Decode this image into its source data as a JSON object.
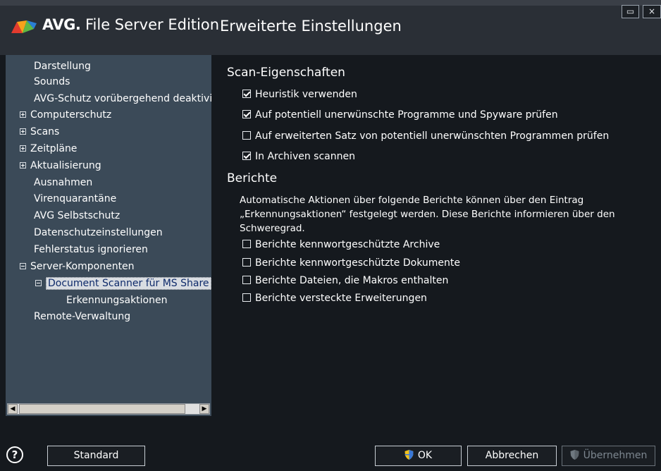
{
  "header": {
    "brand_bold": "AVG.",
    "brand_rest": "File Server Edition",
    "window_title": "Erweiterte Einstellungen",
    "maximize_glyph": "▭",
    "close_glyph": "×"
  },
  "sidebar": {
    "items": [
      {
        "label": "Darstellung"
      },
      {
        "label": "Sounds"
      },
      {
        "label": "AVG-Schutz vorübergehend deaktivie"
      },
      {
        "label": "Computerschutz"
      },
      {
        "label": "Scans"
      },
      {
        "label": "Zeitpläne"
      },
      {
        "label": "Aktualisierung"
      },
      {
        "label": "Ausnahmen"
      },
      {
        "label": "Virenquarantäne"
      },
      {
        "label": "AVG Selbstschutz"
      },
      {
        "label": "Datenschutzeinstellungen"
      },
      {
        "label": "Fehlerstatus ignorieren"
      },
      {
        "label": "Server-Komponenten"
      },
      {
        "label": "Document Scanner für MS Share"
      },
      {
        "label": "Erkennungsaktionen"
      },
      {
        "label": "Remote-Verwaltung"
      }
    ],
    "scroll_left": "◀",
    "scroll_right": "▶"
  },
  "main": {
    "scan_title": "Scan-Eigenschaften",
    "scan_options": [
      {
        "label": "Heuristik verwenden",
        "checked": true
      },
      {
        "label": "Auf potentiell unerwünschte Programme und Spyware prüfen",
        "checked": true
      },
      {
        "label": "Auf erweiterten Satz von potentiell unerwünschten Programmen prüfen",
        "checked": false
      },
      {
        "label": "In Archiven scannen",
        "checked": true
      }
    ],
    "reports_title": "Berichte",
    "reports_description": "Automatische Aktionen über folgende Berichte können über den Eintrag „Erkennungsaktionen“ festgelegt werden. Diese Berichte informieren über den Schweregrad.",
    "report_options": [
      {
        "label": "Berichte kennwortgeschützte Archive",
        "checked": false
      },
      {
        "label": "Berichte kennwortgeschützte Dokumente",
        "checked": false
      },
      {
        "label": "Berichte Dateien, die Makros enthalten",
        "checked": false
      },
      {
        "label": "Berichte versteckte Erweiterungen",
        "checked": false
      }
    ]
  },
  "footer": {
    "help_glyph": "?",
    "standard_label": "Standard",
    "ok_label": "OK",
    "cancel_label": "Abbrechen",
    "apply_label": "Übernehmen"
  },
  "colors": {
    "sidebar_bg": "#3b4a58",
    "main_bg": "#15191e",
    "titlebar_bg": "#2a2f36",
    "selected_text": "#0e2a6a"
  },
  "icons": [
    "avg-logo-icon",
    "help-icon",
    "shield-icon",
    "tree-expander-icon",
    "checkbox-icon"
  ]
}
